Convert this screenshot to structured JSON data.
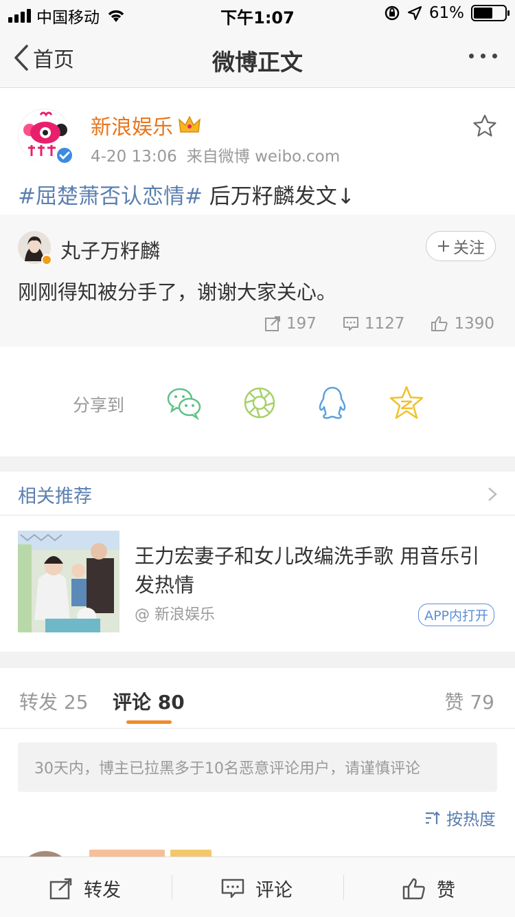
{
  "status_bar": {
    "carrier": "中国移动",
    "time": "下午1:07",
    "battery": "61%",
    "battery_level": 0.61
  },
  "nav": {
    "back_label": "首页",
    "title": "微博正文"
  },
  "post": {
    "author": "新浪娱乐",
    "time": "4-20 13:06",
    "source": "来自微博 weibo.com",
    "topic": "#屈楚萧否认恋情#",
    "text": " 后万籽麟发文↓"
  },
  "retweet": {
    "author": "丸子万籽麟",
    "follow_label": "关注",
    "text": "刚刚得知被分手了，谢谢大家关心。",
    "reposts": "197",
    "comments": "1127",
    "likes": "1390"
  },
  "share": {
    "label": "分享到"
  },
  "related": {
    "header": "相关推荐",
    "title": "王力宏妻子和女儿改编洗手歌 用音乐引发热情",
    "source": "@ 新浪娱乐",
    "app_button": "APP内打开"
  },
  "tabs": {
    "repost_label": "转发",
    "repost_count": "25",
    "comment_label": "评论",
    "comment_count": "80",
    "like_label": "赞",
    "like_count": "79"
  },
  "comments": {
    "notice": "30天内，博主已拉黑多于10名恶意评论用户，请谨慎评论",
    "sort_label": "按热度"
  },
  "bottom_bar": {
    "repost": "转发",
    "comment": "评论",
    "like": "赞"
  },
  "colors": {
    "brand_orange": "#e8761c",
    "link_blue": "#5b7fb0",
    "tab_accent": "#f08a2c"
  }
}
